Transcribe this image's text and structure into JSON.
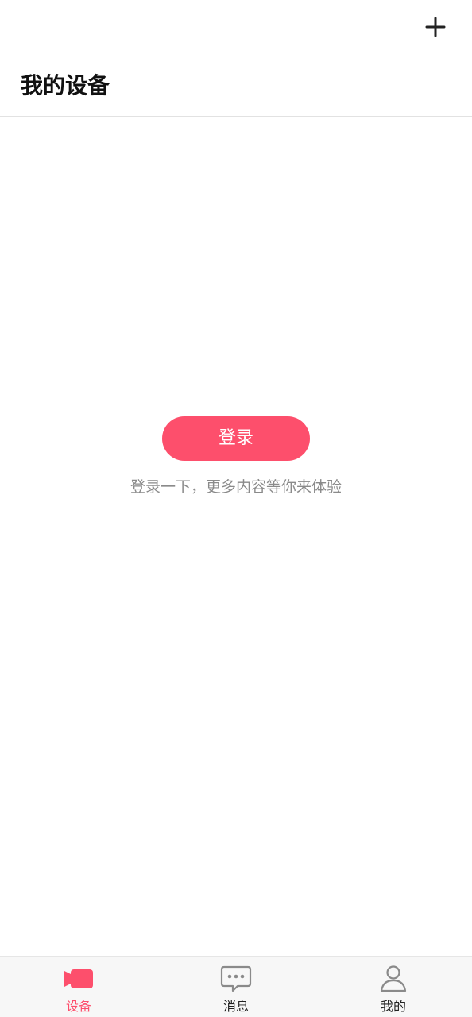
{
  "header": {
    "title": "我的设备",
    "add_icon": "plus-icon"
  },
  "main": {
    "login_button_label": "登录",
    "login_hint": "登录一下，更多内容等你来体验"
  },
  "tabbar": {
    "active_color": "#fd4f6c",
    "tabs": [
      {
        "label": "设备",
        "icon": "video-camera-icon",
        "active": true
      },
      {
        "label": "消息",
        "icon": "chat-bubble-icon",
        "active": false
      },
      {
        "label": "我的",
        "icon": "user-icon",
        "active": false
      }
    ]
  },
  "colors": {
    "accent": "#fd4f6c",
    "hint_text": "#8a8a8a",
    "title_text": "#111111"
  }
}
